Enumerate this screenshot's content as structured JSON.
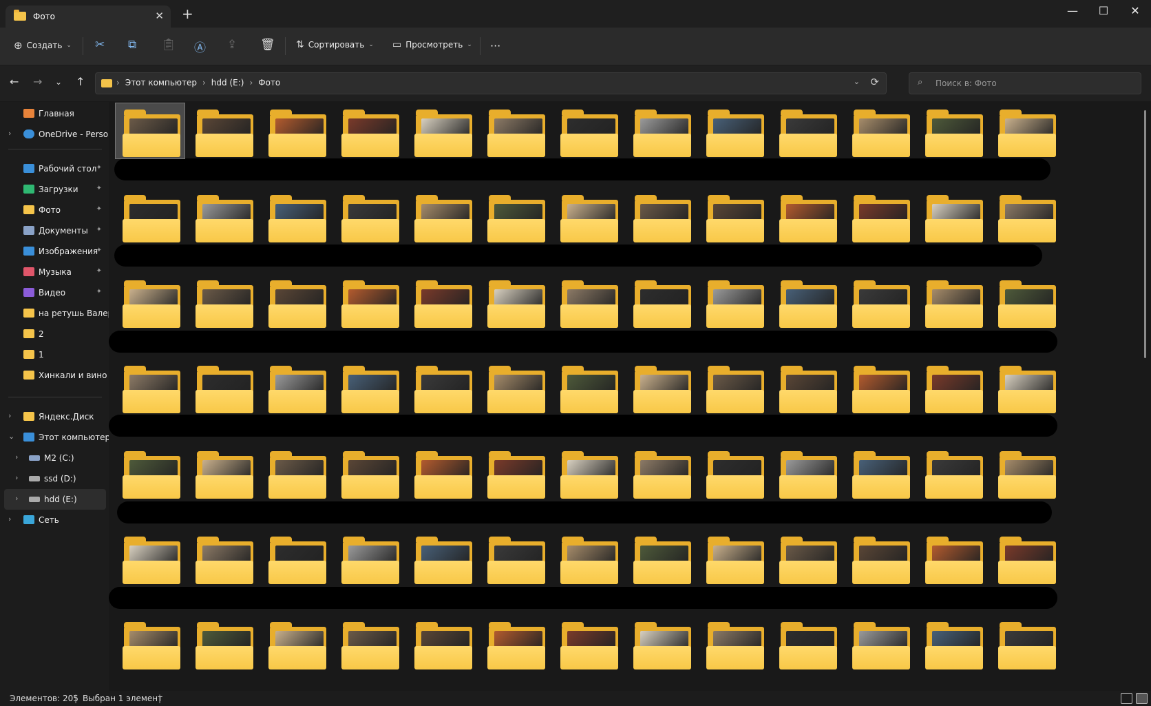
{
  "window": {
    "tab_title": "Фото",
    "tab_close": "✕",
    "new_tab": "+",
    "min": "—",
    "max": "☐",
    "close": "✕"
  },
  "toolbar": {
    "create": "Создать",
    "sort": "Сортировать",
    "view": "Просмотреть",
    "more": "···",
    "caret": "⌄"
  },
  "nav": {
    "back": "←",
    "forward": "→",
    "recent": "⌄",
    "up": "↑"
  },
  "address": {
    "crumbs": [
      "Этот компьютер",
      "hdd (E:)",
      "Фото"
    ],
    "sep": "›",
    "dropdown": "⌄",
    "refresh": "⟳"
  },
  "search": {
    "placeholder": "Поиск в: Фото",
    "icon": "⌕"
  },
  "sidebar": {
    "home": "Главная",
    "onedrive": "OneDrive - Persona",
    "pinned": [
      {
        "label": "Рабочий стол",
        "icon": "desktop-icon",
        "color": "#3a8fd9"
      },
      {
        "label": "Загрузки",
        "icon": "download-icon",
        "color": "#2fb872"
      },
      {
        "label": "Фото",
        "icon": "folder-icon",
        "color": "#f5c44a"
      },
      {
        "label": "Документы",
        "icon": "documents-icon",
        "color": "#8aa2c7"
      },
      {
        "label": "Изображения",
        "icon": "pictures-icon",
        "color": "#3a8fd9"
      },
      {
        "label": "Музыка",
        "icon": "music-icon",
        "color": "#e0566a"
      },
      {
        "label": "Видео",
        "icon": "video-icon",
        "color": "#8b5cd9"
      },
      {
        "label": "на ретушь Валере",
        "icon": "folder-icon",
        "color": "#f5c44a"
      },
      {
        "label": "2",
        "icon": "folder-icon",
        "color": "#f5c44a"
      },
      {
        "label": "1",
        "icon": "folder-icon",
        "color": "#f5c44a"
      },
      {
        "label": "Хинкали и вино",
        "icon": "folder-icon",
        "color": "#f5c44a"
      }
    ],
    "yandex": "Яндекс.Диск",
    "computer": "Этот компьютер",
    "drives": [
      "M2 (C:)",
      "ssd (D:)",
      "hdd (E:)"
    ],
    "network": "Сеть",
    "pin": "📌",
    "chev_right": "›",
    "chev_down": "⌄"
  },
  "status": {
    "count": "Элементов: 205",
    "selected": "Выбран 1 элемент",
    "sep": "|"
  },
  "colors": {
    "accent": "#7fb3e8",
    "folder": "#f8c847",
    "selection": "#4a4a4a"
  },
  "grid": {
    "rows": 7,
    "cols": 13
  }
}
